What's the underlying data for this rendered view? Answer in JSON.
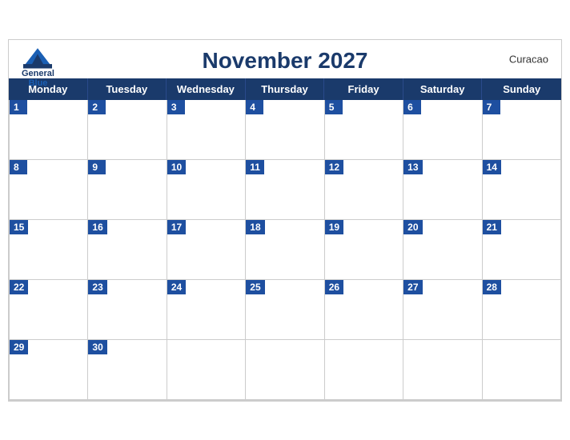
{
  "header": {
    "title": "November 2027",
    "country": "Curacao",
    "logo": {
      "general": "General",
      "blue": "Blue"
    }
  },
  "days_of_week": [
    "Monday",
    "Tuesday",
    "Wednesday",
    "Thursday",
    "Friday",
    "Saturday",
    "Sunday"
  ],
  "weeks": [
    [
      1,
      2,
      3,
      4,
      5,
      6,
      7
    ],
    [
      8,
      9,
      10,
      11,
      12,
      13,
      14
    ],
    [
      15,
      16,
      17,
      18,
      19,
      20,
      21
    ],
    [
      22,
      23,
      24,
      25,
      26,
      27,
      28
    ],
    [
      29,
      30,
      null,
      null,
      null,
      null,
      null
    ]
  ]
}
